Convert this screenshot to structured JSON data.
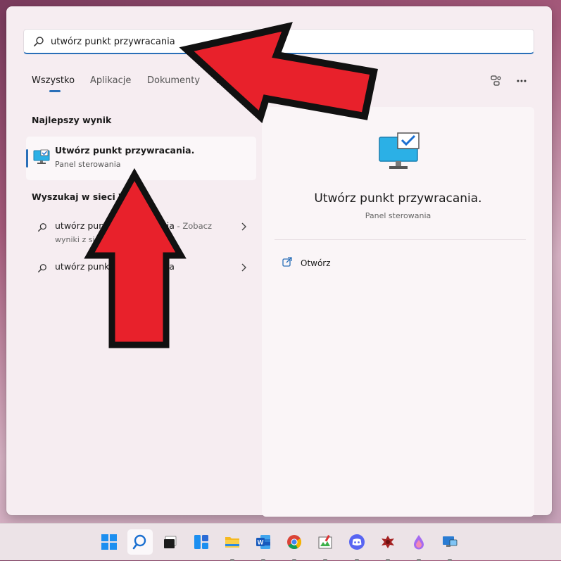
{
  "search": {
    "value": "utwórz punkt przywracania"
  },
  "tabs": [
    {
      "label": "Wszystko",
      "active": true
    },
    {
      "label": "Aplikacje"
    },
    {
      "label": "Dokumenty"
    },
    {
      "label": "In"
    }
  ],
  "top_right_icons": [
    "share-icon",
    "more-icon"
  ],
  "best_match": {
    "heading": "Najlepszy wynik",
    "title": "Utwórz punkt przywracania.",
    "subtitle": "Panel sterowania",
    "icon": "monitor-check-icon"
  },
  "web": {
    "heading": "Wyszukaj w sieci We",
    "items": [
      {
        "text": "utwórz punkt przywracania",
        "suffix": " - Zobacz",
        "line2": "wyniki z sieci"
      },
      {
        "text": "utwórz punkt przywracania",
        "suffix": "",
        "line2": ""
      }
    ]
  },
  "details": {
    "title": "Utwórz punkt przywracania.",
    "subtitle": "Panel sterowania",
    "action_label": "Otwórz",
    "action_icon": "open-external-icon"
  },
  "annotations": [
    "red-arrow-to-search",
    "red-arrow-to-best-result"
  ],
  "taskbar": [
    {
      "name": "windows-start-icon",
      "running": false
    },
    {
      "name": "search-icon",
      "running": false,
      "active": true
    },
    {
      "name": "task-view-icon",
      "running": false
    },
    {
      "name": "widgets-icon",
      "running": false
    },
    {
      "name": "file-explorer-icon",
      "running": true
    },
    {
      "name": "word-icon",
      "running": true
    },
    {
      "name": "chrome-icon",
      "running": true
    },
    {
      "name": "paint-icon",
      "running": true
    },
    {
      "name": "discord-icon",
      "running": true
    },
    {
      "name": "gimp-icon",
      "running": true
    },
    {
      "name": "drop-app-icon",
      "running": true
    },
    {
      "name": "remote-desktop-icon",
      "running": true
    }
  ],
  "colors": {
    "accent": "#2a6fb8",
    "arrow_fill": "#e8212b",
    "arrow_stroke": "#111111",
    "panel": "#f6edf1"
  }
}
